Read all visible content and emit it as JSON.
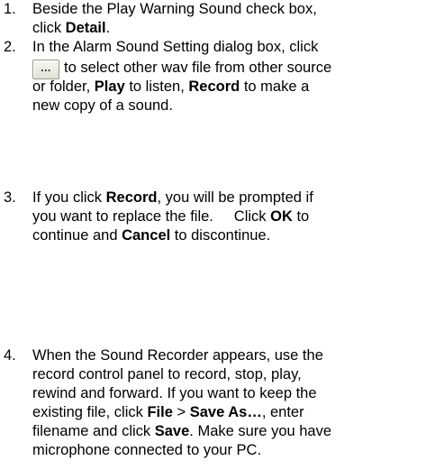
{
  "steps": [
    {
      "number": "1.",
      "line1": "Beside the Play Warning Sound check box,",
      "line2_pre": "click ",
      "line2_bold": "Detail",
      "line2_post": "."
    },
    {
      "number": "2.",
      "line1": "In the Alarm Sound Setting dialog box, click",
      "button_label": "...",
      "line2": "to select other wav file from other source",
      "line3_pre": "or folder, ",
      "line3_bold1": "Play",
      "line3_mid": " to listen, ",
      "line3_bold2": "Record",
      "line3_post": " to make a",
      "line4": "new copy of a sound."
    },
    {
      "number": "3.",
      "line1_pre": "If you click ",
      "line1_bold": "Record",
      "line1_post": ", you will be prompted if",
      "line2_pre": "you want to replace the file.     Click ",
      "line2_bold": "OK",
      "line2_post": " to",
      "line3_pre": "continue and ",
      "line3_bold": "Cancel",
      "line3_post": " to discontinue."
    },
    {
      "number": "4.",
      "line1": "When the Sound Recorder appears, use the",
      "line2": "record control panel to record, stop, play,",
      "line3": "rewind and forward. If you want to keep the",
      "line4_pre": "existing file, click ",
      "line4_bold1": "File",
      "line4_mid": " > ",
      "line4_bold2": "Save As…",
      "line4_post": ", enter",
      "line5_pre": "filename and click ",
      "line5_bold": "Save",
      "line5_post": ". Make sure you have",
      "line6": "microphone connected to your PC."
    }
  ]
}
